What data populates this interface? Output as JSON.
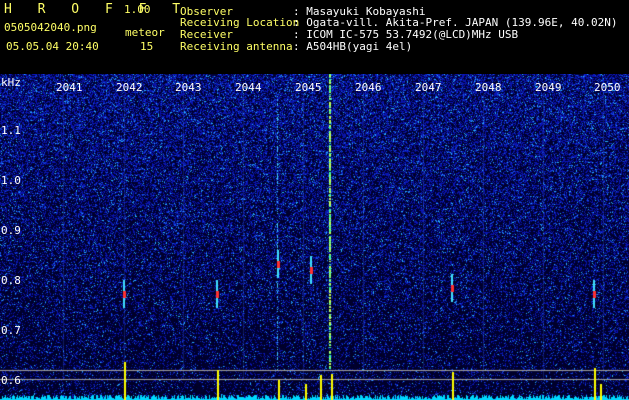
{
  "header": {
    "app_title": "H R O F F T",
    "version": "1.00",
    "filename": "0505042040.png",
    "meteor_label": "meteor",
    "datetime": "05.05.04 20:40",
    "meteor_count": "15",
    "info_labels": [
      "Observer",
      "Receiving Location",
      "Receiver",
      "Receiving antenna"
    ],
    "info_values": [
      ": Masayuki Kobayashi",
      ": Ogata-vill. Akita-Pref. JAPAN (139.96E, 40.02N)",
      ": ICOM IC-575 53.7492(@LCD)MHz USB",
      ": A504HB(yagi 4el)"
    ]
  },
  "spectrogram": {
    "y_unit": "kHz",
    "y_ticks": [
      "1.1",
      "1.0",
      "0.9",
      "0.8",
      "0.7",
      "0.6"
    ],
    "x_ticks": [
      "2041",
      "2042",
      "2043",
      "2044",
      "2045",
      "2046",
      "2047",
      "2048",
      "2049",
      "2050"
    ],
    "colors": {
      "background": "#000028",
      "noise_low": "#0000a0",
      "noise_high": "#40c0ff",
      "meteor_head": "#ff3030",
      "baseline": "#00e0ff",
      "peaks": "#ffff00"
    }
  }
}
